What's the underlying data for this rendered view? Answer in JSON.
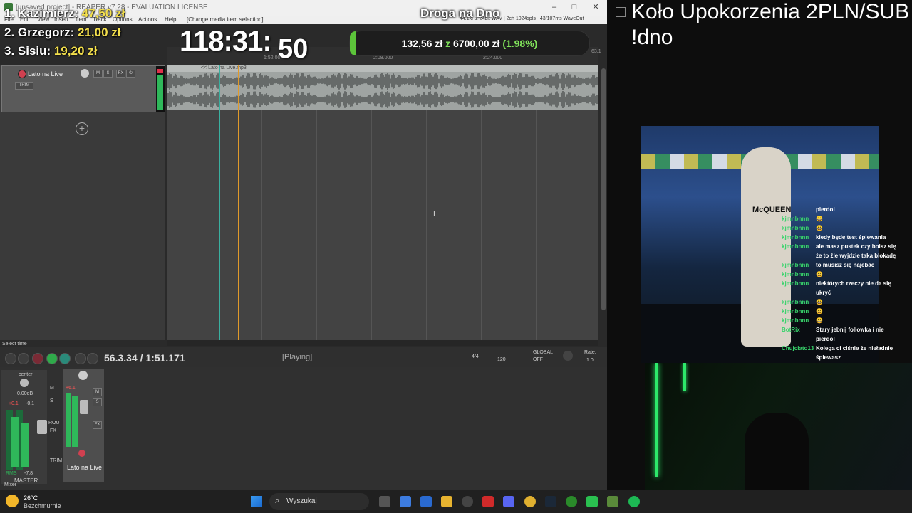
{
  "reaper": {
    "title": "[unsaved project] - REAPER v7.28 - EVALUATION LICENSE",
    "stream_title": "Droga na Dno",
    "format_info": "44.1kHz 24bit WAV | 2ch 1024spls ~43/107ms WaveOut",
    "menu": [
      "File",
      "Edit",
      "View",
      "Insert",
      "Item",
      "Track",
      "Options",
      "Actions",
      "Help",
      "[Change media item selection]"
    ],
    "track": {
      "name": "Lato na Live",
      "trim": "TRIM",
      "item_label": "<< Lato na Live.mp3"
    },
    "ruler_ticks": [
      "1:52.00",
      "2:08.000",
      "2:24.000",
      "63.1"
    ],
    "select_time": "Select time",
    "transport": {
      "position": "56.3.34 / 1:51.171",
      "state": "[Playing]",
      "time_sig": "4/4",
      "bpm": "120",
      "global": "GLOBAL",
      "global_state": "OFF",
      "rate_label": "Rate:",
      "rate": "1.0"
    },
    "mixer": {
      "master_label": "MASTER",
      "track_label": "Lato na Live",
      "center": "center",
      "master_db": "0.00dB",
      "peak": "+0.1",
      "peak2": "-0.1",
      "rms": "RMS",
      "rms_val": "-7.8",
      "track_peak": "+6.1",
      "mixer_tab": "Mixer",
      "buttons": [
        "M",
        "S",
        "FX",
        "ROUTE",
        "TRIM"
      ]
    }
  },
  "overlay": {
    "ranks": [
      {
        "label": "1. Kazimierz:",
        "amount": "47,50 zł"
      },
      {
        "label": "2. Grzegorz:",
        "amount": "21,00 zł"
      },
      {
        "label": "3. Sisiu:",
        "amount": "19,20 zł"
      }
    ],
    "timer_main": "118:31:",
    "timer_sec": "50",
    "goal": {
      "current": "132,56 zł",
      "connector": "z",
      "target": "6700,00 zł",
      "percent": "(1.98%)",
      "progress": 0.0198
    }
  },
  "stream": {
    "title_line1": "Koło Upokorzenia 2PLN/SUB",
    "title_line2": "!dno",
    "chat": [
      {
        "user": "",
        "text": "pierdol"
      },
      {
        "user": "kjmnbnnn",
        "text": "😀"
      },
      {
        "user": "kjmnbnnn",
        "text": "😀"
      },
      {
        "user": "kjmnbnnn",
        "text": "kiedy będę test śpiewania"
      },
      {
        "user": "kjmnbnnn",
        "text": "ale masz pustek czy boisz się"
      },
      {
        "user": "",
        "text": "że to źle wyjdzie taka blokadę"
      },
      {
        "user": "kjmnbnnn",
        "text": "to musisz się najebac"
      },
      {
        "user": "kjmnbnnn",
        "text": "😀"
      },
      {
        "user": "kjmnbnnn",
        "text": "niektórych rzeczy nie da się"
      },
      {
        "user": "",
        "text": "ukryć"
      },
      {
        "user": "kjmnbnnn",
        "text": "😀"
      },
      {
        "user": "kjmnbnnn",
        "text": "😀"
      },
      {
        "user": "kjmnbnnn",
        "text": "😀"
      },
      {
        "user": "BotRix",
        "text": "Stary jebnij followka i nie"
      },
      {
        "user": "",
        "text": "pierdol"
      },
      {
        "user": "Chujciato13",
        "text": "Kolega ci ciśnie że nieładnie"
      },
      {
        "user": "",
        "text": "śpiewasz"
      }
    ],
    "cam1_text": "McQUEEN"
  },
  "taskbar": {
    "weather_temp": "26°C",
    "weather_desc": "Bezchmurnie",
    "search_placeholder": "Wyszukaj"
  },
  "colors": {
    "accent_green": "#5cc43a",
    "gold": "#f4e04d",
    "chat_user": "#38d36b",
    "playcursor": "#e09a2a"
  }
}
